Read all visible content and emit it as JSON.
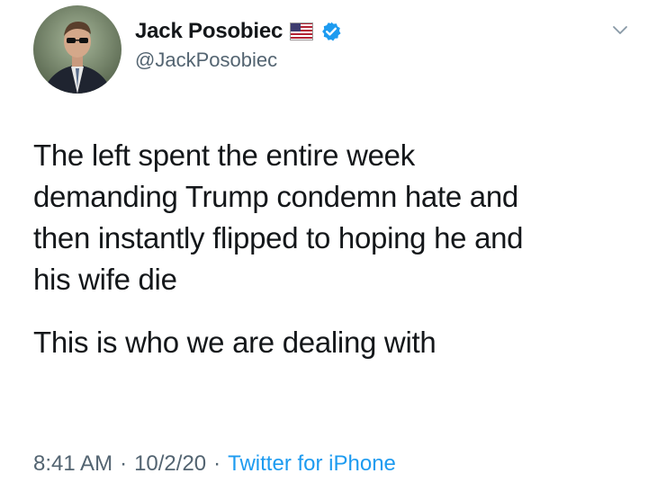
{
  "author": {
    "display_name": "Jack Posobiec",
    "handle": "@JackPosobiec",
    "flag_icon": "us-flag-icon",
    "verified_icon": "verified-badge-icon"
  },
  "tweet": {
    "text_paragraph_1": "The left spent the entire week\ndemanding Trump condemn hate and\nthen instantly flipped to hoping he and\nhis wife die",
    "text_paragraph_2": "This is who we are dealing with"
  },
  "meta": {
    "time": "8:41 AM",
    "separator": "·",
    "date": "10/2/20",
    "source": "Twitter for iPhone"
  },
  "colors": {
    "text_primary": "#14171a",
    "text_secondary": "#536471",
    "accent": "#1d9bf0"
  },
  "menu_icon": "chevron-down-icon"
}
